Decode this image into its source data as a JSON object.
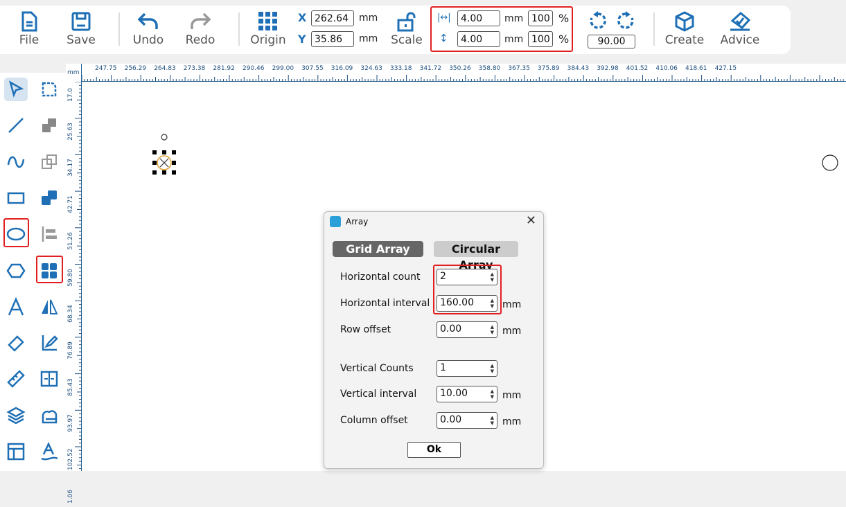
{
  "toolbar": {
    "file": "File",
    "save": "Save",
    "undo": "Undo",
    "redo": "Redo",
    "origin": "Origin",
    "x_label": "X",
    "x_value": "262.64",
    "y_label": "Y",
    "y_value": "35.86",
    "unit": "mm",
    "scale": "Scale",
    "width_value": "4.00",
    "width_pct": "100",
    "height_value": "4.00",
    "height_pct": "100",
    "pct": "%",
    "rotation": "90.00",
    "create": "Create",
    "advice": "Advice"
  },
  "ruler": {
    "unit": "mm",
    "top": [
      "247.75",
      "256.29",
      "264.83",
      "273.38",
      "281.92",
      "290.46",
      "299.00",
      "307.55",
      "316.09",
      "324.63",
      "333.18",
      "341.72",
      "350.26",
      "358.80",
      "367.35",
      "375.89",
      "384.43",
      "392.98",
      "401.52",
      "410.06",
      "418.61",
      "427.15"
    ],
    "left": [
      "17.0",
      "25.63",
      "34.17",
      "42.71",
      "51.26",
      "59.80",
      "68.34",
      "76.89",
      "85.43",
      "93.97",
      "102.52",
      "1.06"
    ]
  },
  "tools": [
    "select-icon",
    "rounded-rect-icon",
    "line-icon",
    "merge-icon",
    "curve-icon",
    "intersect-icon",
    "rectangle-icon",
    "union-icon",
    "ellipse-icon",
    "align-icon",
    "polygon-icon",
    "array-icon",
    "text-icon",
    "mirror-icon",
    "eraser-icon",
    "edit-node-icon",
    "ruler-icon",
    "fit-icon",
    "layers-icon",
    "cloud-icon",
    "layout-icon",
    "text-path-icon"
  ],
  "dialog": {
    "title": "Array",
    "tab_grid": "Grid Array",
    "tab_circular": "Circular Array",
    "fields": [
      {
        "label": "Horizontal count",
        "value": "2",
        "unit": ""
      },
      {
        "label": "Horizontal interval",
        "value": "160.00",
        "unit": "mm"
      },
      {
        "label": "Row offset",
        "value": "0.00",
        "unit": "mm"
      },
      {
        "label": "Vertical Counts",
        "value": "1",
        "unit": ""
      },
      {
        "label": "Vertical interval",
        "value": "10.00",
        "unit": "mm"
      },
      {
        "label": "Column offset",
        "value": "0.00",
        "unit": "mm"
      }
    ],
    "ok": "Ok"
  },
  "colors": {
    "accent": "#1e6fb5",
    "highlight": "#e02020"
  }
}
